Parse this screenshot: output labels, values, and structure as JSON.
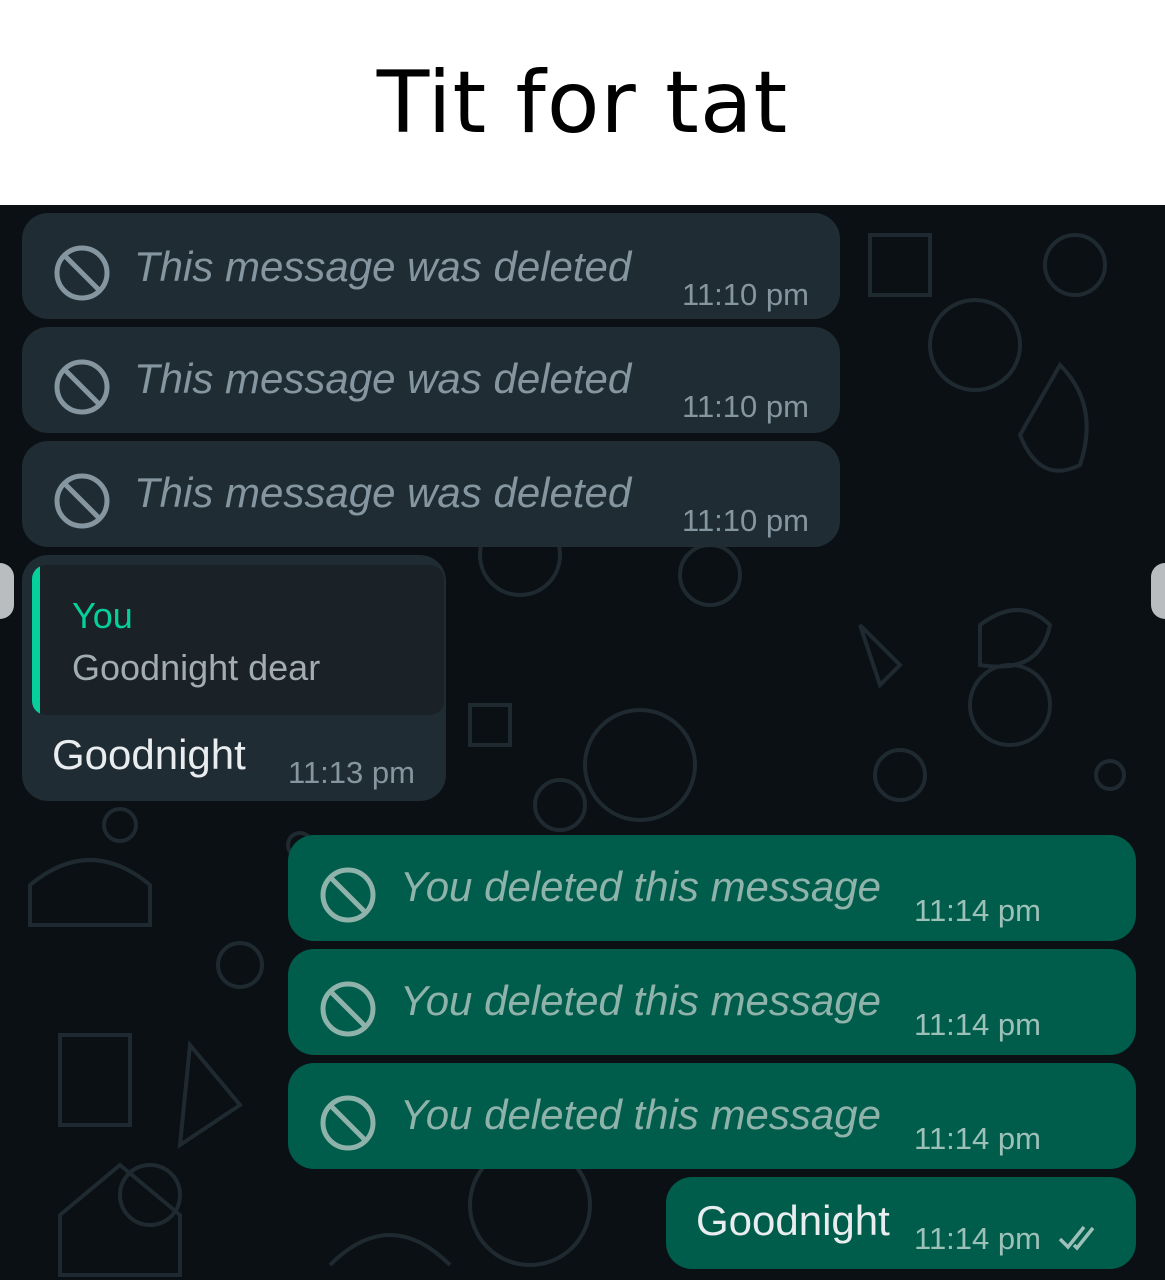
{
  "caption": {
    "title": "Tit for tat"
  },
  "colors": {
    "chat_background": "#0b1014",
    "incoming_bubble": "#1f2c33",
    "outgoing_bubble": "#005c4b",
    "quote_accent": "#06cf9c",
    "muted_text": "#8696a0"
  },
  "incoming": {
    "deleted": [
      {
        "text": "This message was deleted",
        "time": "11:10 pm",
        "icon": "ban-icon"
      },
      {
        "text": "This message was deleted",
        "time": "11:10 pm",
        "icon": "ban-icon"
      },
      {
        "text": "This message was deleted",
        "time": "11:10 pm",
        "icon": "ban-icon"
      }
    ],
    "reply": {
      "quote_author": "You",
      "quote_text": "Goodnight dear",
      "text": "Goodnight",
      "time": "11:13 pm"
    }
  },
  "outgoing": {
    "deleted": [
      {
        "text": "You deleted this message",
        "time": "11:14 pm",
        "icon": "ban-icon"
      },
      {
        "text": "You deleted this message",
        "time": "11:14 pm",
        "icon": "ban-icon"
      },
      {
        "text": "You deleted this message",
        "time": "11:14 pm",
        "icon": "ban-icon"
      }
    ],
    "final": {
      "text": "Goodnight",
      "time": "11:14 pm",
      "status_icon": "double-check-icon"
    }
  }
}
